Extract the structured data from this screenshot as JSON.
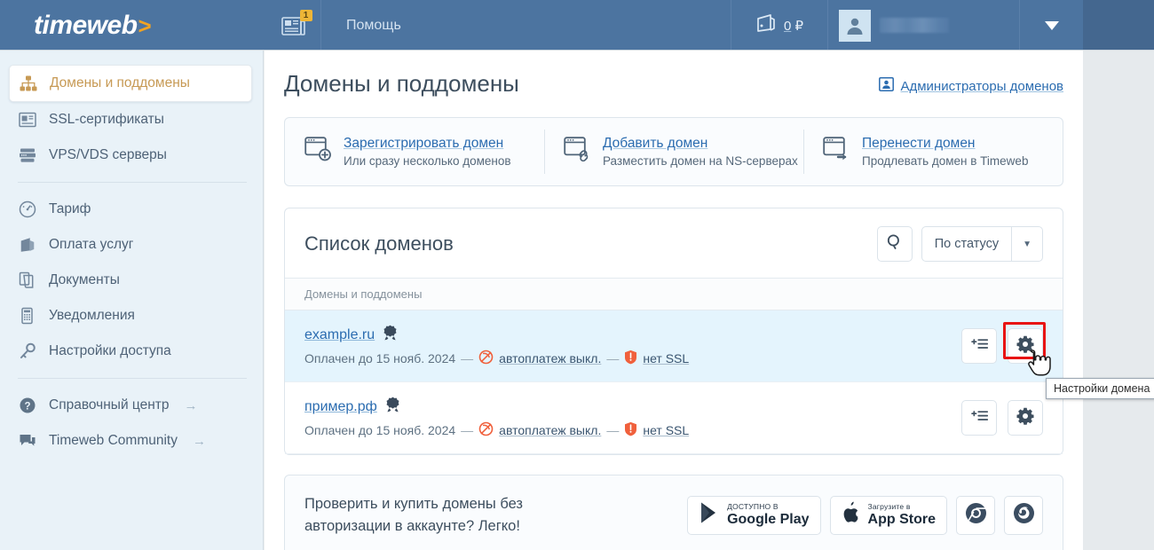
{
  "topbar": {
    "logo_text": "timeweb",
    "logo_arrow": ">",
    "news_badge": "1",
    "help_label": "Помощь",
    "wallet_amount": "0",
    "wallet_currency": "₽",
    "user_name": ""
  },
  "sidebar": {
    "items": [
      {
        "label": "Домены и поддомены",
        "icon": "sitemap-icon",
        "active": true
      },
      {
        "label": "SSL-сертификаты",
        "icon": "certificate-icon",
        "active": false
      },
      {
        "label": "VPS/VDS серверы",
        "icon": "server-icon",
        "active": false
      },
      {
        "label": "Тариф",
        "icon": "gauge-icon",
        "active": false
      },
      {
        "label": "Оплата услуг",
        "icon": "wallet-icon",
        "active": false
      },
      {
        "label": "Документы",
        "icon": "documents-icon",
        "active": false
      },
      {
        "label": "Уведомления",
        "icon": "notifications-icon",
        "active": false
      },
      {
        "label": "Настройки доступа",
        "icon": "key-icon",
        "active": false
      },
      {
        "label": "Справочный центр",
        "icon": "help-circle-icon",
        "active": false,
        "external": "→"
      },
      {
        "label": "Timeweb Community",
        "icon": "chat-icon",
        "active": false,
        "external": "→"
      }
    ]
  },
  "page": {
    "title": "Домены и поддомены",
    "admins_link": "Администраторы доменов"
  },
  "quick_actions": [
    {
      "title": "Зарегистрировать домен",
      "subtitle": "Или сразу несколько доменов",
      "icon": "window-plus-icon"
    },
    {
      "title": "Добавить домен",
      "subtitle": "Разместить домен на NS-серверах",
      "icon": "window-link-icon"
    },
    {
      "title": "Перенести домен",
      "subtitle": "Продлевать домен в Timeweb",
      "icon": "window-arrow-icon"
    }
  ],
  "domain_list": {
    "title": "Список доменов",
    "search_icon": "search-icon",
    "filter_label": "По статусу",
    "column_header": "Домены и поддомены",
    "rows": [
      {
        "name": "example.ru",
        "paid_until": "Оплачен до 15 нояб. 2024",
        "dash": "—",
        "autopay": "автоплатеж выкл.",
        "ssl": "нет SSL",
        "hovered": true
      },
      {
        "name": "пример.рф",
        "paid_until": "Оплачен до 15 нояб. 2024",
        "dash": "—",
        "autopay": "автоплатеж выкл.",
        "ssl": "нет SSL",
        "hovered": false
      }
    ],
    "row_actions": [
      {
        "name": "add-subdomain-button",
        "icon": "list-plus-icon"
      },
      {
        "name": "domain-settings-button",
        "icon": "gear-icon"
      }
    ]
  },
  "tooltip": {
    "text": "Настройки домена"
  },
  "highlight": {
    "color": "#e81414"
  },
  "promo": {
    "line1": "Проверить и купить домены без",
    "line2": "авторизации в аккаунте? Легко!",
    "badges": [
      {
        "name": "google-play-badge",
        "small": "ДОСТУПНО В",
        "big": "Google Play"
      },
      {
        "name": "app-store-badge",
        "small": "Загрузите в",
        "big": "App Store"
      },
      {
        "name": "chrome-extension-badge",
        "icon": "chrome-icon"
      },
      {
        "name": "firefox-extension-badge",
        "icon": "firefox-icon"
      }
    ]
  },
  "colors": {
    "topbar": "#4c74a0",
    "accent_orange": "#f0a323",
    "link_blue": "#2b6cb0",
    "sidebar_bg": "#e9f2f8",
    "row_hover": "#e4f4fd",
    "highlight_red": "#e81414"
  }
}
